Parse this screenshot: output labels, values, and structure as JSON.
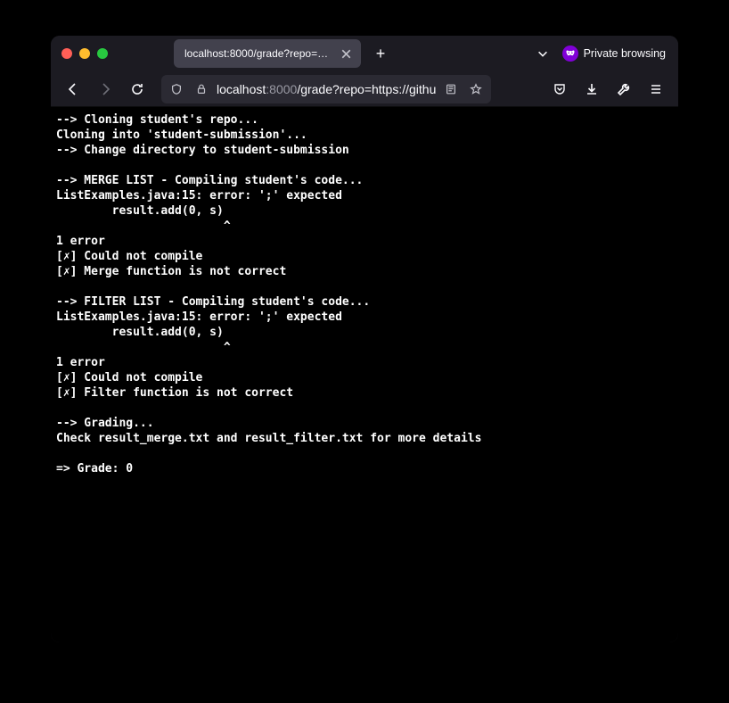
{
  "tab": {
    "title": "localhost:8000/grade?repo=https://g"
  },
  "private_label": "Private browsing",
  "url": {
    "host_dim": "localhost",
    "host_port": ":8000",
    "path": "/grade?repo=https://githu"
  },
  "console": {
    "lines": [
      "--> Cloning student's repo...",
      "Cloning into 'student-submission'...",
      "--> Change directory to student-submission",
      "",
      "--> MERGE LIST - Compiling student's code...",
      "ListExamples.java:15: error: ';' expected",
      "        result.add(0, s)",
      "                        ^",
      "1 error",
      "[✗] Could not compile",
      "[✗] Merge function is not correct",
      "",
      "--> FILTER LIST - Compiling student's code...",
      "ListExamples.java:15: error: ';' expected",
      "        result.add(0, s)",
      "                        ^",
      "1 error",
      "[✗] Could not compile",
      "[✗] Filter function is not correct",
      "",
      "--> Grading...",
      "Check result_merge.txt and result_filter.txt for more details",
      "",
      "=> Grade: 0"
    ]
  }
}
